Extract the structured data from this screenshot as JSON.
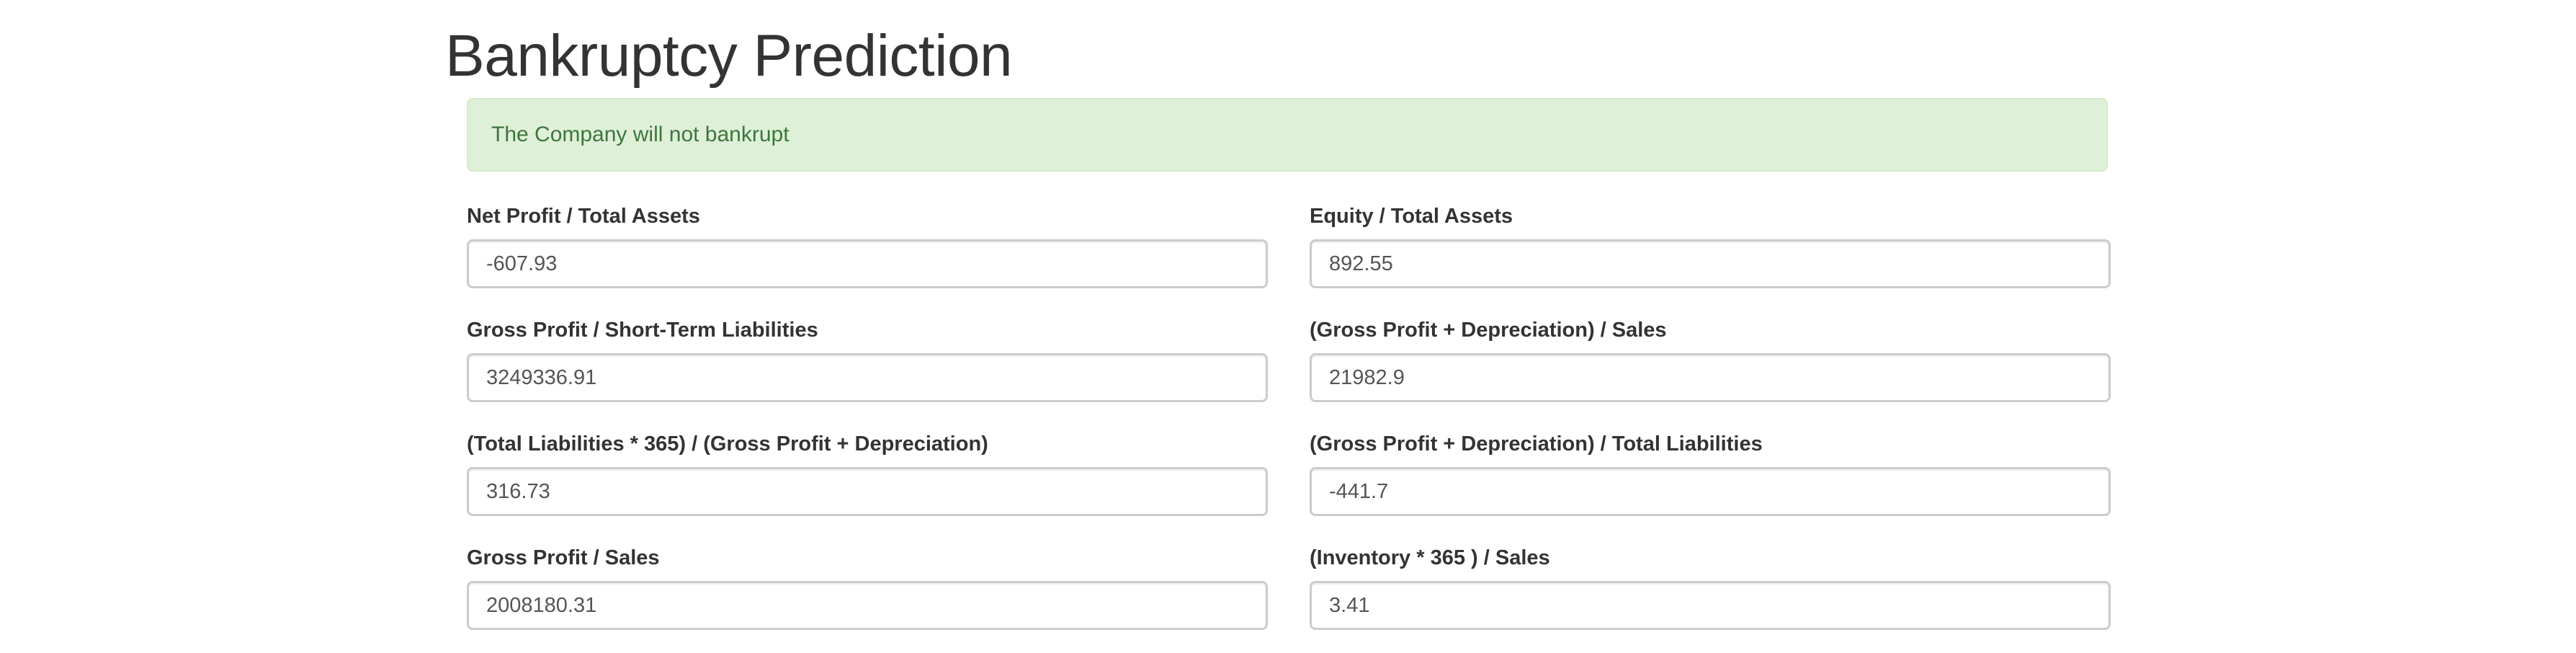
{
  "page": {
    "title": "Bankruptcy Prediction"
  },
  "alert": {
    "message": "The Company will not bankrupt",
    "color": "#3c763d",
    "background": "#dff0d8"
  },
  "fields": [
    {
      "label": "Net Profit / Total Assets",
      "value": "-607.93"
    },
    {
      "label": "Equity / Total Assets",
      "value": "892.55"
    },
    {
      "label": "Gross Profit / Short-Term Liabilities",
      "value": "3249336.91"
    },
    {
      "label": "(Gross Profit + Depreciation) / Sales",
      "value": "21982.9"
    },
    {
      "label": "(Total Liabilities * 365) / (Gross Profit + Depreciation)",
      "value": "316.73"
    },
    {
      "label": "(Gross Profit + Depreciation) / Total Liabilities",
      "value": "-441.7"
    },
    {
      "label": "Gross Profit / Sales",
      "value": "2008180.31"
    },
    {
      "label": "(Inventory * 365 ) / Sales",
      "value": "3.41"
    }
  ]
}
